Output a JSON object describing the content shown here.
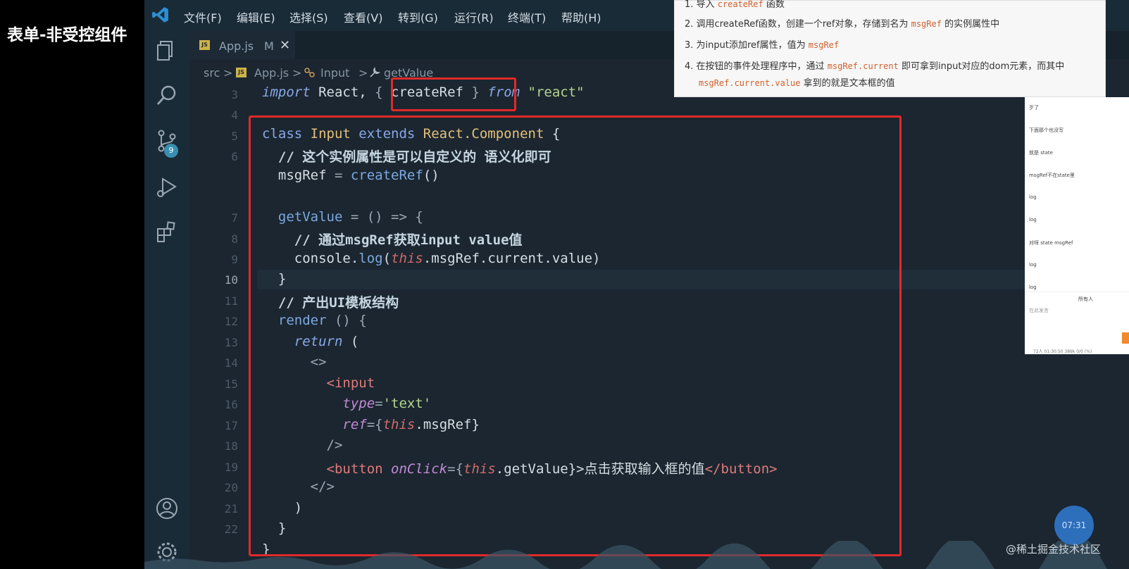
{
  "overlay": {
    "title": "表单-非受控组件"
  },
  "menu": {
    "items": [
      "文件(F)",
      "编辑(E)",
      "选择(S)",
      "查看(V)",
      "转到(G)",
      "运行(R)",
      "终端(T)",
      "帮助(H)"
    ]
  },
  "activity": {
    "scm_badge": "9"
  },
  "tab": {
    "js_label": "JS",
    "name": "App.js",
    "modified": "M",
    "close": "✕"
  },
  "breadcrumb": {
    "parts": [
      "src",
      "App.js",
      "Input",
      "getValue"
    ],
    "sep": ">"
  },
  "code": {
    "line_numbers": [
      "3",
      "4",
      "5",
      "6",
      "7",
      "8",
      "9",
      "10",
      "11",
      "12",
      "13",
      "14",
      "15",
      "16",
      "17",
      "18",
      "19",
      "20",
      "21",
      "22"
    ],
    "active_line": "10",
    "l1": {
      "import": "import",
      "react": " React, ",
      "brace_open": "{ ",
      "createRef": "createRef",
      "brace_close": " }",
      "from": " from ",
      "src": "\"react\""
    },
    "l3": {
      "class": "class ",
      "name": "Input",
      "extends": " extends ",
      "base": "React.Component",
      "brace": " {"
    },
    "l4": "  // 这个实例属性是可以自定义的 语义化即可",
    "l5": {
      "indent": "  ",
      "prop": "msgRef",
      "eq": " = ",
      "call": "createRef",
      "paren": "()"
    },
    "l7": {
      "indent": "  ",
      "fn": "getValue",
      "rest": " = () => {"
    },
    "l8": "    // 通过msgRef获取input value值",
    "l9": {
      "indent": "    ",
      "obj": "console.",
      "fn": "log",
      "po": "(",
      "this": "this",
      "rest": ".msgRef.current.value)"
    },
    "l10": "  }",
    "l11": "  // 产出UI模板结构",
    "l12": {
      "indent": "  ",
      "fn": "render",
      "rest": " () {"
    },
    "l13": {
      "indent": "    ",
      "kw": "return",
      "rest": " ("
    },
    "l14": "      <>",
    "l15": {
      "indent": "        ",
      "tag": "<input"
    },
    "l16": {
      "indent": "          ",
      "attr": "type",
      "eq": "=",
      "val": "'text'"
    },
    "l17": {
      "indent": "          ",
      "attr": "ref",
      "eq": "={",
      "this": "this",
      "rest": ".msgRef}"
    },
    "l18": "        />",
    "l19": {
      "indent": "        ",
      "tag": "<button",
      "sp": " ",
      "attr": "onClick",
      "eq": "={",
      "this": "this",
      "rest": ".getValue}",
      "text": ">点击获取输入框的值",
      "close": "</button>"
    },
    "l20": "      </>",
    "l21": "    )",
    "l22": "  }",
    "l23": "}"
  },
  "doc": {
    "items": [
      {
        "num": "1.",
        "pre": "导入 ",
        "code": "createRef",
        "post": " 函数"
      },
      {
        "num": "2.",
        "pre": "调用createRef函数，创建一个ref对象，存储到名为 ",
        "code": "msgRef",
        "post": " 的实例属性中"
      },
      {
        "num": "3.",
        "pre": "为input添加ref属性，值为 ",
        "code": "msgRef",
        "post": ""
      },
      {
        "num": "4.",
        "pre": "在按钮的事件处理程序中，通过 ",
        "code": "msgRef.current",
        "post": " 即可拿到input对应的dom元素，而其中"
      },
      {
        "num": "",
        "pre": "",
        "code": "msgRef.current.value",
        "post": " 拿到的就是文本框的值"
      }
    ]
  },
  "chat": {
    "messages": [
      "歹了",
      "下面那个也没写",
      "就是 state",
      "msgRef不在state里",
      "log",
      "log",
      "对呀 state msgRef",
      "log",
      "log"
    ],
    "input_placeholder": "在此发言",
    "recipient": "所有人",
    "stats": "72人  01:30:50  389k  0/0 (%)"
  },
  "clock": "07:31",
  "watermark": "@稀土掘金技术社区",
  "colors": {
    "highlight": "#e02a2a",
    "editor_bg": "#1b2630",
    "accent": "#3a8fb0"
  }
}
